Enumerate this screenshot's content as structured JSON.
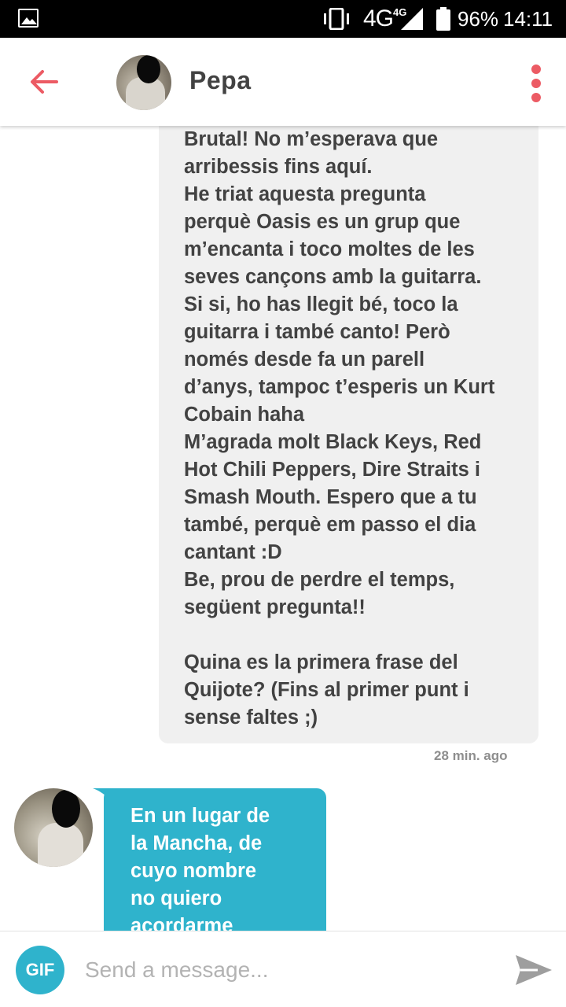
{
  "status_bar": {
    "network": "4G",
    "network_small": "4G",
    "battery": "96%",
    "time": "14:11"
  },
  "header": {
    "contact_name": "Pepa",
    "back_icon": "arrow-left-icon",
    "menu_icon": "more-vertical-icon"
  },
  "messages": {
    "received_text": "Brutal! No m’esperava que\narribessis fins aquí.\nHe triat aquesta pregunta\nperquè Oasis es un grup que\nm’encanta i toco moltes de les\nseves cançons amb la guitarra.\nSi si, ho has llegit bé, toco la\nguitarra i també canto! Però\nnomés desde fa un parell\nd’anys, tampoc t’esperis un Kurt\nCobain haha\nM’agrada molt Black Keys, Red\nHot Chili Peppers, Dire Straits i\nSmash Mouth. Espero que a tu\ntambé, perquè em passo el dia\ncantant :D\nBe, prou de perdre el temps,\nsegüent pregunta!!\n\nQuina es la primera frase del\nQuijote? (Fins al primer punt i\nsense faltes ;)",
    "received_time": "28 min. ago",
    "reply_text": "En un lugar de\nla Mancha, de\ncuyo nombre\nno quiero\nacordarme"
  },
  "composer": {
    "gif_label": "GIF",
    "placeholder": "Send a message...",
    "send_icon": "send-icon"
  },
  "colors": {
    "accent": "#ec5b64",
    "teal": "#2fb3cc",
    "bubble_grey": "#f0f0f0",
    "text": "#424242"
  }
}
